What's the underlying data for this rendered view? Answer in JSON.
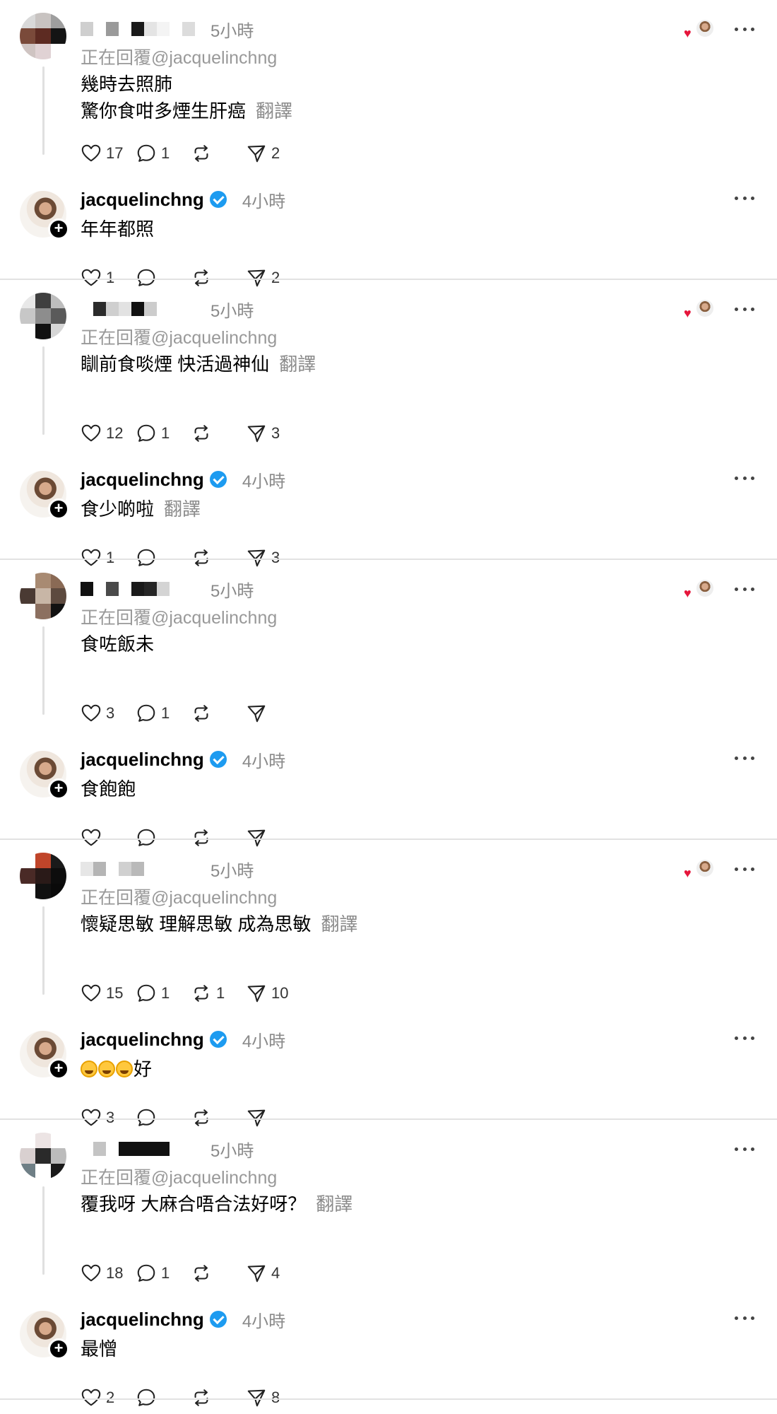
{
  "threads": [
    {
      "reply": {
        "timestamp": "5小時",
        "reply_to": "正在回覆@jacquelinchng",
        "lines": [
          "幾時去照肺",
          "驚你食咁多煙生肝癌"
        ],
        "translate": "翻譯",
        "liked_by_author": true,
        "likes": "17",
        "comments": "1",
        "reposts": "",
        "shares": "2",
        "avatar_colors": [
          "#d9d9d9",
          "#c8c3c1",
          "#9e9e9e",
          "#7a4a3a",
          "#5d2b22",
          "#141414",
          "#cfc4c2",
          "#e0d2d4",
          "#ffffff"
        ],
        "name_blocks": [
          "#cfcfcf",
          "#ffffff",
          "#9a9a9a",
          "#ffffff",
          "#1a1a1a",
          "#e4e4e4",
          "#f4f4f4",
          "#ffffff",
          "#dcdcdc"
        ]
      },
      "owner": {
        "username": "jacquelinchng",
        "timestamp": "4小時",
        "lines": [
          "年年都照"
        ],
        "translate": "",
        "likes": "1",
        "comments": "",
        "reposts": "",
        "shares": "2"
      }
    },
    {
      "reply": {
        "timestamp": "5小時",
        "reply_to": "正在回覆@jacquelinchng",
        "lines": [
          "瞓前食啖煙 快活過神仙"
        ],
        "translate": "翻譯",
        "liked_by_author": true,
        "likes": "12",
        "comments": "1",
        "reposts": "",
        "shares": "3",
        "avatar_colors": [
          "#e8e8e8",
          "#3f3f3f",
          "#bdbdbd",
          "#c7c7c7",
          "#8d8d8d",
          "#5a5a5a",
          "#ffffff",
          "#111111",
          "#d6d6d6"
        ],
        "name_blocks": [
          "#ffffff",
          "#2b2b2b",
          "#cfcfcf",
          "#e2e2e2",
          "#111111",
          "#cccccc",
          "#ffffff",
          "#ffffff",
          "#ffffff"
        ]
      },
      "owner": {
        "username": "jacquelinchng",
        "timestamp": "4小時",
        "lines": [
          "食少啲啦"
        ],
        "translate": "翻譯",
        "likes": "1",
        "comments": "",
        "reposts": "",
        "shares": "3"
      }
    },
    {
      "reply": {
        "timestamp": "5小時",
        "reply_to": "正在回覆@jacquelinchng",
        "lines": [
          "食咗飯未"
        ],
        "translate": "",
        "liked_by_author": true,
        "likes": "3",
        "comments": "1",
        "reposts": "",
        "shares": "",
        "avatar_colors": [
          "#ffffff",
          "#a88a72",
          "#8a6a55",
          "#4a3a33",
          "#c8b6a6",
          "#5d4a3f",
          "#ffffff",
          "#8c7060",
          "#111111"
        ],
        "name_blocks": [
          "#111111",
          "#ffffff",
          "#4a4a4a",
          "#ffffff",
          "#1a1a1a",
          "#262626",
          "#d4d4d4",
          "#ffffff",
          "#ffffff"
        ]
      },
      "owner": {
        "username": "jacquelinchng",
        "timestamp": "4小時",
        "lines": [
          "食飽飽"
        ],
        "translate": "",
        "likes": "",
        "comments": "",
        "reposts": "",
        "shares": ""
      }
    },
    {
      "reply": {
        "timestamp": "5小時",
        "reply_to": "正在回覆@jacquelinchng",
        "lines": [
          "懷疑思敏 理解思敏 成為思敏"
        ],
        "translate": "翻譯",
        "liked_by_author": true,
        "likes": "15",
        "comments": "1",
        "reposts": "1",
        "shares": "10",
        "avatar_colors": [
          "#ffffff",
          "#c0452a",
          "#1a1a1a",
          "#4a2a26",
          "#2a1a18",
          "#0d0d0d",
          "#ffffff",
          "#111111",
          "#0a0a0a"
        ],
        "name_blocks": [
          "#e6e6e6",
          "#b5b5b5",
          "#ffffff",
          "#d0d0d0",
          "#b9b9b9",
          "#ffffff",
          "#ffffff",
          "#ffffff",
          "#ffffff"
        ]
      },
      "owner": {
        "username": "jacquelinchng",
        "timestamp": "4小時",
        "lines": [
          "好"
        ],
        "emoji_prefix": [
          "laughing-emoji",
          "laughing-emoji",
          "laughing-emoji"
        ],
        "translate": "",
        "likes": "3",
        "comments": "",
        "reposts": "",
        "shares": ""
      }
    },
    {
      "reply": {
        "timestamp": "5小時",
        "reply_to": "正在回覆@jacquelinchng",
        "lines": [
          "覆我呀 大麻合唔合法好呀？"
        ],
        "translate": "翻譯",
        "liked_by_author": false,
        "likes": "18",
        "comments": "1",
        "reposts": "",
        "shares": "4",
        "avatar_colors": [
          "#ffffff",
          "#ece4e4",
          "#ffffff",
          "#d9d0d0",
          "#2a2a2a",
          "#bcbcbc",
          "#6f7f86",
          "#ffffff",
          "#1a1a1a"
        ],
        "name_blocks": [
          "#ffffff",
          "#c4c4c4",
          "#ffffff",
          "#111111",
          "#111111",
          "#111111",
          "#111111",
          "#ffffff",
          "#ffffff"
        ]
      },
      "owner": {
        "username": "jacquelinchng",
        "timestamp": "4小時",
        "lines": [
          "最憎"
        ],
        "translate": "",
        "likes": "2",
        "comments": "",
        "reposts": "",
        "shares": "8"
      }
    }
  ]
}
